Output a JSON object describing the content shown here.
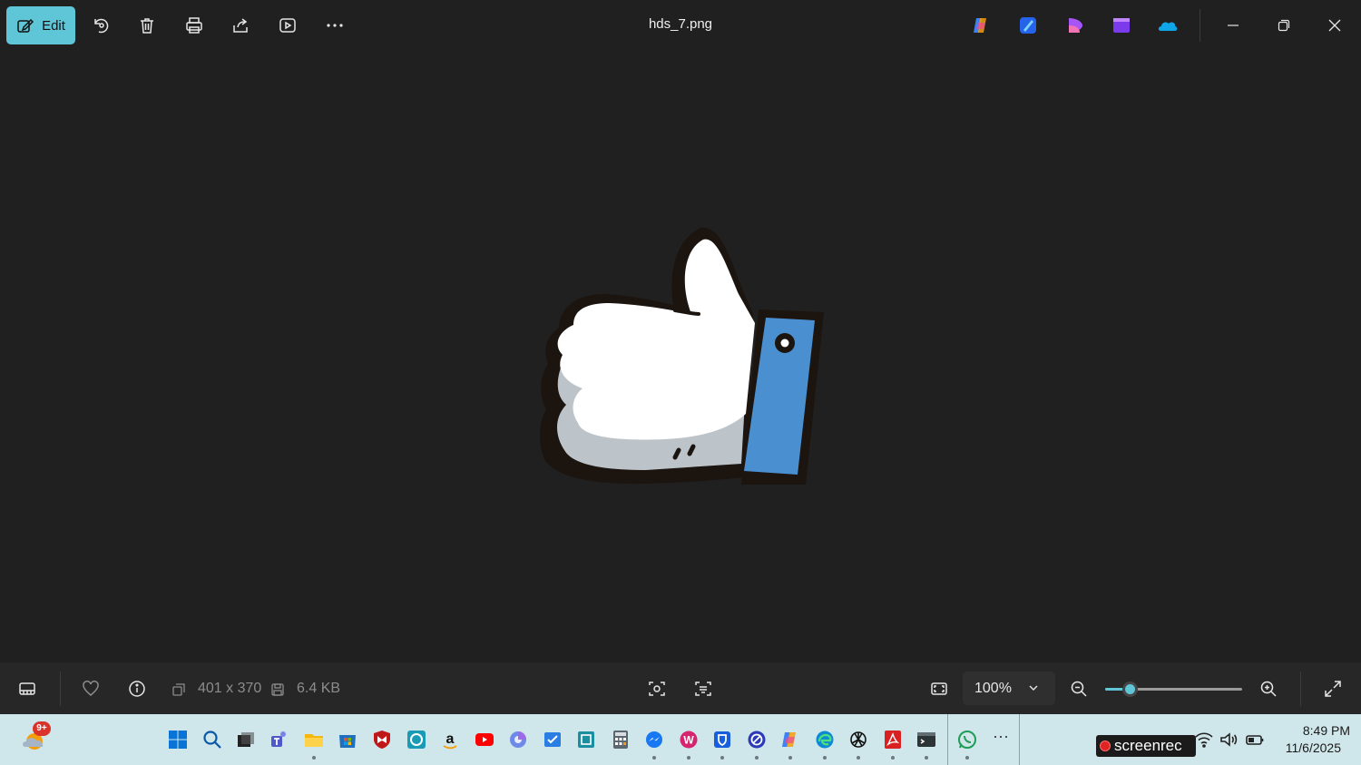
{
  "window": {
    "title": "hds_7.png",
    "edit_label": "Edit"
  },
  "toolbar": {
    "items": [
      "rotate-icon",
      "delete-icon",
      "print-icon",
      "share-icon",
      "slideshow-icon",
      "more-icon"
    ]
  },
  "app_shortcuts": [
    "copilot-icon",
    "photos-designer-icon",
    "clipchamp-icon",
    "video-editor-icon",
    "onedrive-icon"
  ],
  "infobar": {
    "dimensions": "401 x 370",
    "file_size": "6.4 KB",
    "zoom": "100%",
    "zoom_level_fraction": 0.18
  },
  "taskbar": {
    "weather_badge": "9+",
    "screenrec_label": "screenrec",
    "time": "8:49 PM",
    "date": "11/6/2025"
  },
  "colors": {
    "accent": "#5fc6d8",
    "background": "#202020",
    "infobar": "#272727",
    "taskbar": "#cfe6ea",
    "cuff_blue": "#4a90d1"
  }
}
